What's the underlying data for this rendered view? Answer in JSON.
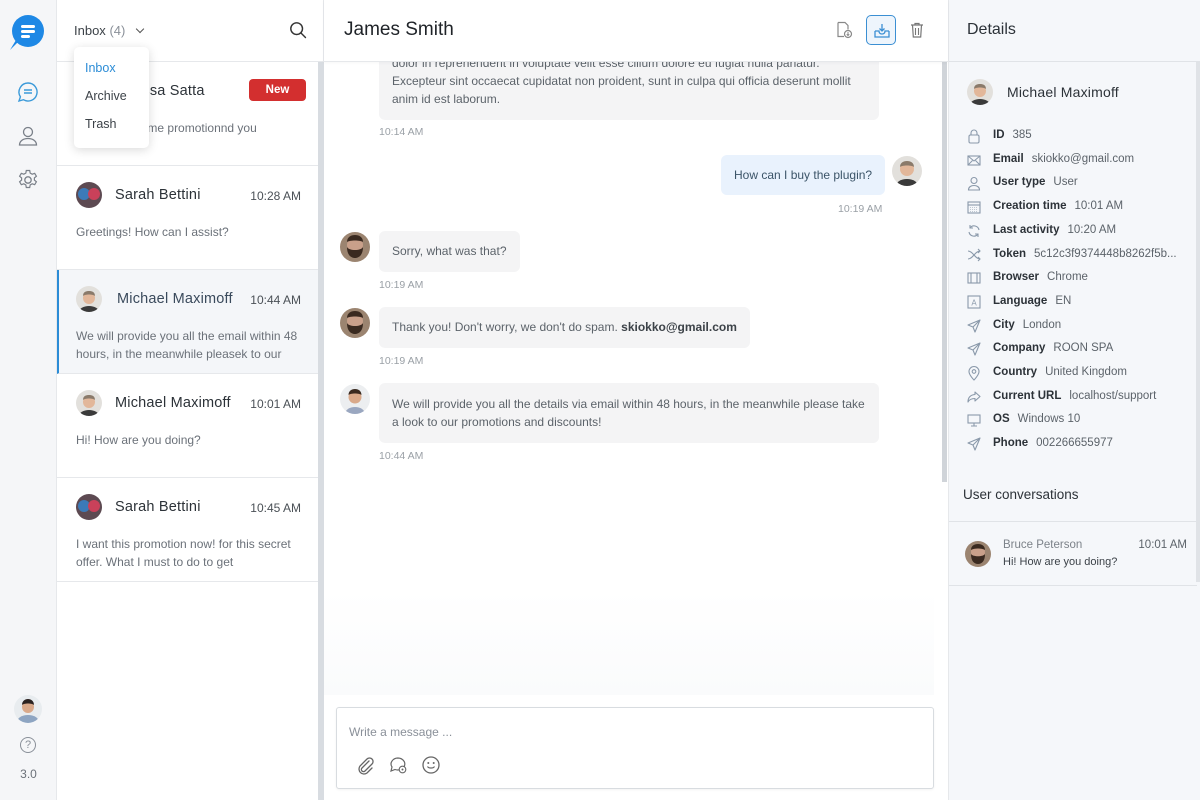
{
  "rail": {
    "items": [
      {
        "icon": "chat-icon",
        "active": true
      },
      {
        "icon": "user-icon",
        "active": false
      },
      {
        "icon": "gear-icon",
        "active": false
      }
    ],
    "help_glyph": "?",
    "version": "3.0"
  },
  "list": {
    "folder_label": "Inbox",
    "folder_count": "(4)",
    "dropdown": [
      "Inbox",
      "Archive",
      "Trash"
    ],
    "dropdown_selected": "Inbox",
    "conversations": [
      {
        "name": "Melissa Satta",
        "badge": "New",
        "message": "Can not help me promotionnd you",
        "active": false
      },
      {
        "name": "Sarah Bettini",
        "time": "10:28 AM",
        "message": "Greetings! How can I assist?",
        "active": false
      },
      {
        "name": "Michael Maximoff",
        "time": "10:44 AM",
        "message": "We will provide you all the  email within 48 hours, in the meanwhile pleasek to our",
        "active": true
      },
      {
        "name": "Michael Maximoff",
        "time": "10:01 AM",
        "message": "Hi! How are you doing?",
        "active": false
      },
      {
        "name": "Sarah Bettini",
        "time": "10:45 AM",
        "message": "I want this promotion now! for this secret offer. What I must to do to get",
        "active": false
      }
    ]
  },
  "chat": {
    "title": "James Smith",
    "actions": [
      "transcript-icon",
      "archive-icon",
      "delete-icon"
    ],
    "messages": [
      {
        "side": "agent",
        "text_lines": [
          "dolor in reprehenderit in voluptate velit esse cillum dolore eu fugiat nulla pariatur.",
          "Excepteur sint occaecat cupidatat non proident, sunt in culpa qui officia deserunt mollit",
          "anim id est laborum."
        ],
        "time": "10:14 AM"
      },
      {
        "side": "user",
        "text": "How can I buy the plugin?",
        "time": "10:19 AM"
      },
      {
        "side": "agent",
        "text": "Sorry, what was that?",
        "time": "10:19 AM"
      },
      {
        "side": "agent",
        "text": "Thank you! Don't worry, we don't do spam. ",
        "bold": "skiokko@gmail.com",
        "time": "10:19 AM"
      },
      {
        "side": "agent",
        "text_lines": [
          "We will provide you all the details via email within 48 hours, in the meanwhile please take",
          "a look to our promotions and discounts!"
        ],
        "time": "10:44 AM"
      }
    ],
    "composer_placeholder": "Write a message ...",
    "composer_value": "",
    "composer_icons": [
      "attachment-icon",
      "saved-replies-icon",
      "emoji-icon"
    ]
  },
  "details": {
    "title": "Details",
    "profile_name": "Michael Maximoff",
    "rows": [
      {
        "icon": "lock-icon",
        "label": "ID",
        "value": "385"
      },
      {
        "icon": "mail-icon",
        "label": "Email",
        "value": "skiokko@gmail.com"
      },
      {
        "icon": "user-icon",
        "label": "User type",
        "value": "User"
      },
      {
        "icon": "calendar-icon",
        "label": "Creation time",
        "value": "10:01 AM"
      },
      {
        "icon": "refresh-icon",
        "label": "Last activity",
        "value": "10:20 AM"
      },
      {
        "icon": "shuffle-icon",
        "label": "Token",
        "value": "5c12c3f9374448b8262f5b..."
      },
      {
        "icon": "browser-icon",
        "label": "Browser",
        "value": "Chrome"
      },
      {
        "icon": "language-icon",
        "label": "Language",
        "value": "EN"
      },
      {
        "icon": "send-icon",
        "label": "City",
        "value": "London"
      },
      {
        "icon": "send-icon",
        "label": "Company",
        "value": "ROON SPA"
      },
      {
        "icon": "location-icon",
        "label": "Country",
        "value": "United Kingdom"
      },
      {
        "icon": "share-icon",
        "label": "Current URL",
        "value": "localhost/support"
      },
      {
        "icon": "monitor-icon",
        "label": "OS",
        "value": "Windows 10"
      },
      {
        "icon": "send-icon",
        "label": "Phone",
        "value": "002266655977"
      }
    ],
    "user_conversations_title": "User conversations",
    "user_conversations": [
      {
        "name": "Bruce Peterson",
        "time": "10:01 AM",
        "message": "Hi! How are you doing?"
      }
    ]
  },
  "colors": {
    "accent": "#2b8cd6",
    "new_badge": "#d32f2f",
    "user_bubble": "#e9f2fd",
    "agent_bubble": "#f4f4f5"
  }
}
